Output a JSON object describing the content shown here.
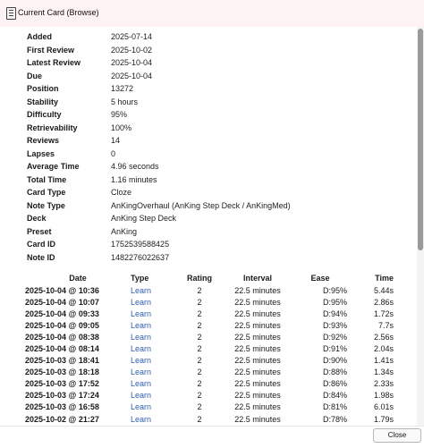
{
  "window": {
    "title": "Current Card (Browse)"
  },
  "card_info": [
    {
      "label": "Added",
      "value": "2025-07-14"
    },
    {
      "label": "First Review",
      "value": "2025-10-02"
    },
    {
      "label": "Latest Review",
      "value": "2025-10-04"
    },
    {
      "label": "Due",
      "value": "2025-10-04"
    },
    {
      "label": "Position",
      "value": "13272"
    },
    {
      "label": "Stability",
      "value": "5 hours"
    },
    {
      "label": "Difficulty",
      "value": "95%"
    },
    {
      "label": "Retrievability",
      "value": "100%"
    },
    {
      "label": "Reviews",
      "value": "14"
    },
    {
      "label": "Lapses",
      "value": "0"
    },
    {
      "label": "Average Time",
      "value": "4.96 seconds"
    },
    {
      "label": "Total Time",
      "value": "1.16 minutes"
    },
    {
      "label": "Card Type",
      "value": "Cloze"
    },
    {
      "label": "Note Type",
      "value": "AnKingOverhaul (AnKing Step Deck / AnKingMed)"
    },
    {
      "label": "Deck",
      "value": "AnKing Step Deck"
    },
    {
      "label": "Preset",
      "value": "AnKing"
    },
    {
      "label": "Card ID",
      "value": "1752539588425"
    },
    {
      "label": "Note ID",
      "value": "1482276022637"
    }
  ],
  "reviews": {
    "headers": [
      "Date",
      "Type",
      "Rating",
      "Interval",
      "Ease",
      "Time"
    ],
    "rows": [
      [
        "2025-10-04 @ 10:36",
        "Learn",
        "2",
        "22.5 minutes",
        "D:95%",
        "5.44s"
      ],
      [
        "2025-10-04 @ 10:07",
        "Learn",
        "2",
        "22.5 minutes",
        "D:95%",
        "2.86s"
      ],
      [
        "2025-10-04 @ 09:33",
        "Learn",
        "2",
        "22.5 minutes",
        "D:94%",
        "1.72s"
      ],
      [
        "2025-10-04 @ 09:05",
        "Learn",
        "2",
        "22.5 minutes",
        "D:93%",
        "7.7s"
      ],
      [
        "2025-10-04 @ 08:38",
        "Learn",
        "2",
        "22.5 minutes",
        "D:92%",
        "2.56s"
      ],
      [
        "2025-10-04 @ 08:14",
        "Learn",
        "2",
        "22.5 minutes",
        "D:91%",
        "2.04s"
      ],
      [
        "2025-10-03 @ 18:41",
        "Learn",
        "2",
        "22.5 minutes",
        "D:90%",
        "1.41s"
      ],
      [
        "2025-10-03 @ 18:18",
        "Learn",
        "2",
        "22.5 minutes",
        "D:88%",
        "1.34s"
      ],
      [
        "2025-10-03 @ 17:52",
        "Learn",
        "2",
        "22.5 minutes",
        "D:86%",
        "2.33s"
      ],
      [
        "2025-10-03 @ 17:24",
        "Learn",
        "2",
        "22.5 minutes",
        "D:84%",
        "1.98s"
      ],
      [
        "2025-10-03 @ 16:58",
        "Learn",
        "2",
        "22.5 minutes",
        "D:81%",
        "6.01s"
      ],
      [
        "2025-10-02 @ 21:27",
        "Learn",
        "2",
        "22.5 minutes",
        "D:78%",
        "1.79s"
      ]
    ]
  },
  "footer": {
    "close_label": "Close"
  },
  "icons": {
    "app": "app-window-icon"
  }
}
